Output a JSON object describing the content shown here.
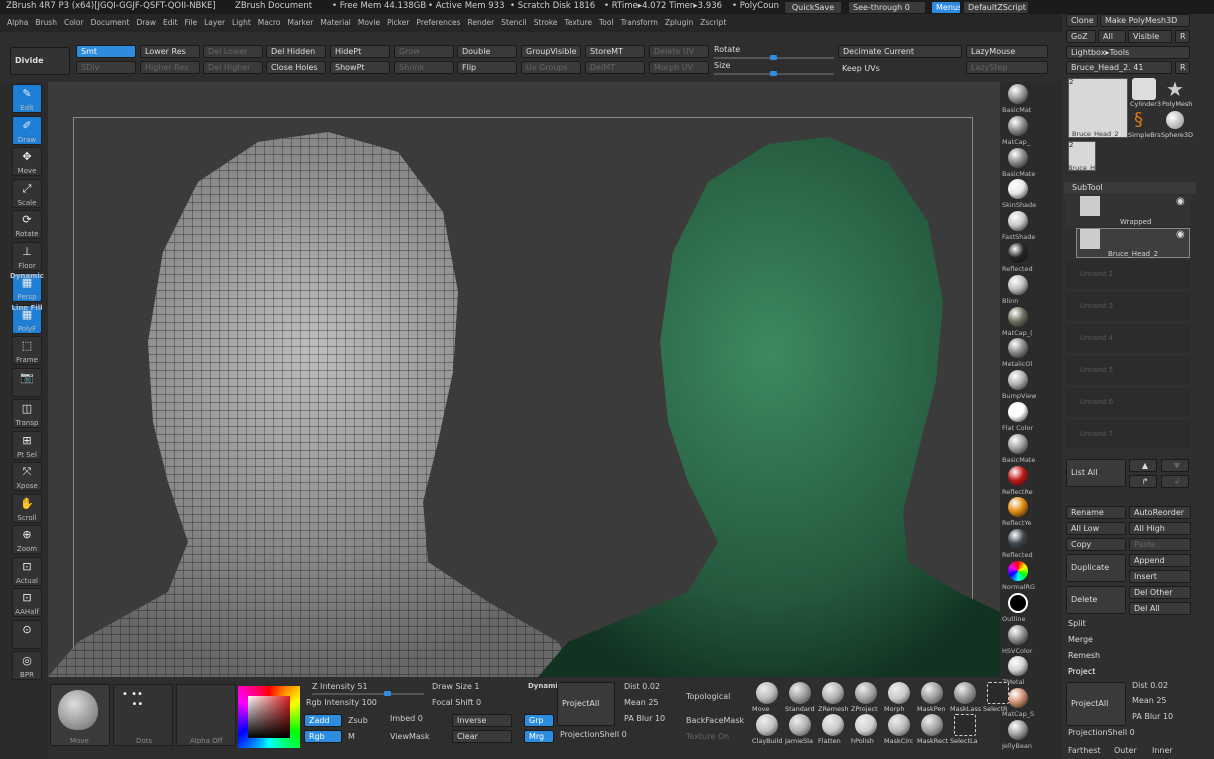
{
  "title_bar": {
    "app": "ZBrush 4R7 P3 (x64)[JGQI-GGJF-QSFT-QOII-NBKE]",
    "doc": "ZBrush Document",
    "free_mem": "• Free Mem 44.138GB",
    "active_mem": "• Active Mem 933",
    "scratch": "• Scratch Disk 1816",
    "rtime": "• RTime▸4.072 Timer▸3.936",
    "polycount": "• PolyCoun",
    "quicksave": "QuickSave",
    "seethrough": "See-through 0",
    "menus": "Menus",
    "script": "DefaultZScript"
  },
  "menubar": [
    "Alpha",
    "Brush",
    "Color",
    "Document",
    "Draw",
    "Edit",
    "File",
    "Layer",
    "Light",
    "Macro",
    "Marker",
    "Material",
    "Movie",
    "Picker",
    "Preferences",
    "Render",
    "Stencil",
    "Stroke",
    "Texture",
    "Tool",
    "Transform",
    "Zplugin",
    "Zscript"
  ],
  "toolbar": {
    "divide": "Divide",
    "smt": "Smt",
    "sdiv": "SDiv",
    "lower_res": "Lower Res",
    "higher_res": "Higher Res",
    "del_lower": "Del Lower",
    "del_higher": "Del Higher",
    "del_hidden": "Del Hidden",
    "close_holes": "Close Holes",
    "hidept": "HidePt",
    "showpt": "ShowPt",
    "grow": "Grow",
    "shrink": "Shrink",
    "double": "Double",
    "flip": "Flip",
    "groupvisible": "GroupVisible",
    "uvgroups": "Uv Groups",
    "storemt": "StoreMT",
    "delmt": "DelMT",
    "deleteuv": "Delete UV",
    "morphuv": "Morph UV",
    "rotate": "Rotate",
    "size": "Size",
    "decimate": "Decimate Current",
    "keepuvs": "Keep UVs",
    "lazymouse": "LazyMouse",
    "lazystep": "LazyStep"
  },
  "left_shelf": [
    "Edit",
    "Draw",
    "Move",
    "Scale",
    "Rotate",
    "Floor",
    "Persp",
    "PolyF",
    "Frame",
    "",
    "Transp",
    "Pt Sel",
    "Xpose",
    "Scroll",
    "Zoom",
    "Actual",
    "AAHalf",
    "",
    "BPR"
  ],
  "left_shelf_top_labels": {
    "persp_top": "Dynamic",
    "polyf_top": "Line Fill"
  },
  "materials": [
    "BasicMat",
    "MatCap_",
    "BasicMate",
    "SkinShade",
    "FastShade",
    "Reflected",
    "Blinn",
    "MatCap_(",
    "MetalicOl",
    "BumpView",
    "Flat Color",
    "BasicMate",
    "ReflectRe",
    "ReflectYe",
    "Reflected",
    "NormalRG",
    "Outline",
    "HSVColor",
    "ZMetal",
    "MatCap_S",
    "JellyBean"
  ],
  "material_colors": [
    "#9a9a9a",
    "#8d8d8d",
    "#8a8a8a",
    "#e8e8e8",
    "#c8c8c8",
    "#252525",
    "#bdbdbd",
    "#707060",
    "#8a8a8a",
    "#b0b0b0",
    "#ffffff",
    "#a0a0a0",
    "#c01818",
    "#e08a10",
    "#404850",
    "#rainbow",
    "#000000",
    "#909090",
    "#d0d0d0",
    "#d09070",
    "#a0a0a0"
  ],
  "right_panel": {
    "clone": "Clone",
    "make_polymesh": "Make PolyMesh3D",
    "goz": "GoZ",
    "all": "All",
    "visible": "Visible",
    "r": "R",
    "lightbox_tools": "Lightbox▸Tools",
    "tool_name": "Bruce_Head_2. 41",
    "tools": [
      "Bruce_Head_2",
      "Cylinder3",
      "PolyMesh",
      "SimpleBrs",
      "Sphere3D",
      "Bruce_H"
    ],
    "subtool": "SubTool",
    "subtool_items": [
      "Wrapped",
      "Bruce_Head_2"
    ],
    "unused": [
      "Unused 2",
      "Unused 3",
      "Unused 4",
      "Unused 5",
      "Unused 6",
      "Unused 7"
    ],
    "list_all": "List All",
    "rename": "Rename",
    "autoreorder": "AutoReorder",
    "all_low": "All Low",
    "all_high": "All High",
    "copy": "Copy",
    "paste": "Paste",
    "duplicate": "Duplicate",
    "append": "Append",
    "insert": "Insert",
    "delete": "Delete",
    "del_other": "Del Other",
    "del_all": "Del All",
    "split": "Split",
    "merge": "Merge",
    "remesh": "Remesh",
    "project": "Project",
    "projectall": "ProjectAll",
    "dist": "Dist 0.02",
    "mean": "Mean 25",
    "pa_blur": "PA Blur 10",
    "projectionshell": "ProjectionShell 0",
    "farthest": "Farthest",
    "outer": "Outer",
    "inner": "Inner",
    "badge_two": "2"
  },
  "bottom": {
    "move": "Move",
    "dots": "Dots",
    "alpha_off": "Alpha Off",
    "z_intensity": "Z Intensity 51",
    "rgb_intensity": "Rgb Intensity 100",
    "zadd": "Zadd",
    "zsub": "Zsub",
    "rgb": "Rgb",
    "m": "M",
    "draw_size": "Draw Size 1",
    "focal_shift": "Focal Shift 0",
    "imbed": "Imbed 0",
    "viewmask": "ViewMask",
    "dynamic": "Dynamic",
    "inverse": "Inverse",
    "clear": "Clear",
    "grp": "Grp",
    "mrg": "Mrg",
    "projectall": "ProjectAll",
    "projectionshell": "ProjectionShell 0",
    "dist": "Dist 0.02",
    "mean": "Mean 25",
    "pa_blur": "PA Blur 10",
    "topological": "Topological",
    "backfacemask": "BackFaceMask",
    "texture_on": "Texture On",
    "brushes": [
      "Move",
      "Standard",
      "ZRemesh",
      "ZProject",
      "Morph",
      "MaskPen",
      "MaskLass",
      "SelectR",
      "ClayBuild",
      "JamieSla",
      "Flatten",
      "hPolish",
      "MaskCirc",
      "MaskRect",
      "SelectLa"
    ]
  },
  "colors": {
    "accent": "#2d8be0",
    "green_head": "#2f6b4a",
    "wire_head": "#bcbcbc"
  }
}
